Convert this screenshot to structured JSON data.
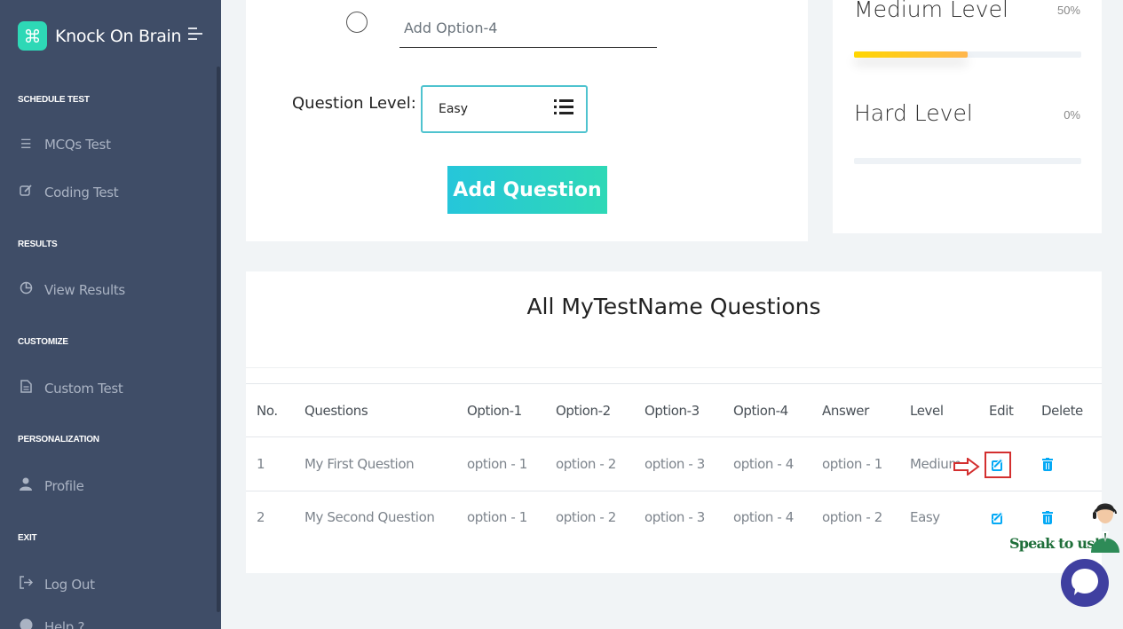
{
  "brand": {
    "name": "Knock On Brain",
    "logo_glyph": "⌘"
  },
  "sidebar": {
    "sections": [
      {
        "label": "SCHEDULE TEST",
        "items": [
          {
            "label": "MCQs Test",
            "icon": "list-icon"
          },
          {
            "label": "Coding Test",
            "icon": "edit-icon"
          }
        ]
      },
      {
        "label": "RESULTS",
        "items": [
          {
            "label": "View Results",
            "icon": "pie-chart-icon"
          }
        ]
      },
      {
        "label": "CUSTOMIZE",
        "items": [
          {
            "label": "Custom Test",
            "icon": "file-icon"
          }
        ]
      },
      {
        "label": "PERSONALIZATION",
        "items": [
          {
            "label": "Profile",
            "icon": "user-icon"
          }
        ]
      },
      {
        "label": "EXIT",
        "items": [
          {
            "label": "Log Out",
            "icon": "logout-icon"
          },
          {
            "label": "Help ?",
            "icon": "help-icon"
          }
        ]
      }
    ]
  },
  "form": {
    "option4_placeholder": "Add Option-4",
    "question_level_label": "Question Level:",
    "question_level_value": "Easy",
    "add_button": "Add Question"
  },
  "levels": [
    {
      "name": "Medium Level",
      "percent_label": "50%",
      "progress": 0.5
    },
    {
      "name": "Hard Level",
      "percent_label": "0%",
      "progress": 0
    }
  ],
  "questions_table": {
    "title": "All MyTestName Questions",
    "headers": [
      "No.",
      "Questions",
      "Option-1",
      "Option-2",
      "Option-3",
      "Option-4",
      "Answer",
      "Level",
      "Edit",
      "Delete"
    ],
    "rows": [
      {
        "no": "1",
        "question": "My First Question",
        "option1": "option - 1",
        "option2": "option - 2",
        "option3": "option - 3",
        "option4": "option - 4",
        "answer": "option - 1",
        "level": "Medium"
      },
      {
        "no": "2",
        "question": "My Second Question",
        "option1": "option - 1",
        "option2": "option - 2",
        "option3": "option - 3",
        "option4": "option - 4",
        "answer": "option - 2",
        "level": "Easy"
      }
    ]
  },
  "chat": {
    "speak_label": "Speak to us!"
  },
  "colors": {
    "sidebar_bg": "#3f4d67",
    "accent": "#04a9f5",
    "teal": "#2ed8b6",
    "highlight": "#d32f2f"
  }
}
